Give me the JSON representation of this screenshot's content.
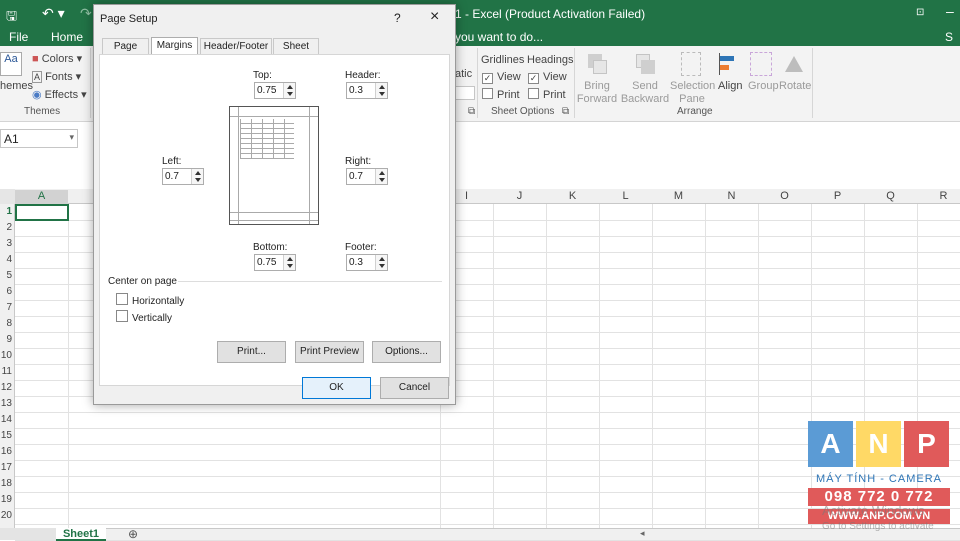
{
  "window": {
    "title": "1 - Excel (Product Activation Failed)"
  },
  "ribbon_tabs": [
    "File",
    "Home",
    "you want to do..."
  ],
  "ribbon": {
    "themes": {
      "label": "hemes",
      "colors": "Colors",
      "fonts": "Fonts",
      "effects": "Effects",
      "group": "Themes"
    },
    "scale_fragments": [
      "atic",
      "atic"
    ],
    "sheet_options": {
      "gridlines": "Gridlines",
      "headings": "Headings",
      "view": "View",
      "print": "Print",
      "group": "Sheet Options"
    },
    "arrange": {
      "bring_forward": "Bring Forward",
      "send_backward": "Send Backward",
      "selection_pane": "Selection Pane",
      "align": "Align",
      "group_btn": "Group",
      "rotate": "Rotate",
      "group": "Arrange"
    }
  },
  "name_box": "A1",
  "columns": [
    "A",
    "I",
    "J",
    "K",
    "L",
    "M",
    "N",
    "O",
    "P",
    "Q",
    "R"
  ],
  "rows": [
    "1",
    "2",
    "3",
    "4",
    "5",
    "6",
    "7",
    "8",
    "9",
    "10",
    "11",
    "12",
    "13",
    "14",
    "15",
    "16",
    "17",
    "18",
    "19",
    "20"
  ],
  "sheet_tab": "Sheet1",
  "dialog": {
    "title": "Page Setup",
    "help": "?",
    "close": "×",
    "tabs": [
      "Page",
      "Margins",
      "Header/Footer",
      "Sheet"
    ],
    "top_label": "Top:",
    "top_value": "0.75",
    "header_label": "Header:",
    "header_value": "0.3",
    "left_label": "Left:",
    "left_value": "0.7",
    "right_label": "Right:",
    "right_value": "0.7",
    "bottom_label": "Bottom:",
    "bottom_value": "0.75",
    "footer_label": "Footer:",
    "footer_value": "0.3",
    "center_label": "Center on page",
    "horizontally": "Horizontally",
    "vertically": "Vertically",
    "print_btn": "Print...",
    "preview_btn": "Print Preview",
    "options_btn": "Options...",
    "ok_btn": "OK",
    "cancel_btn": "Cancel"
  },
  "watermark": {
    "letters": [
      "A",
      "N",
      "P"
    ],
    "line1": "MÁY TÍNH - CAMERA",
    "phone": "098 772 0 772",
    "site": "WWW.ANP.COM.VN",
    "activate1": "Activate Windows",
    "activate2": "Go to Settings to activate"
  },
  "colors": {
    "excel_green": "#217346",
    "anp_blue": "#5b9bd5",
    "anp_yellow": "#ffd966",
    "anp_red": "#e05a5a"
  }
}
